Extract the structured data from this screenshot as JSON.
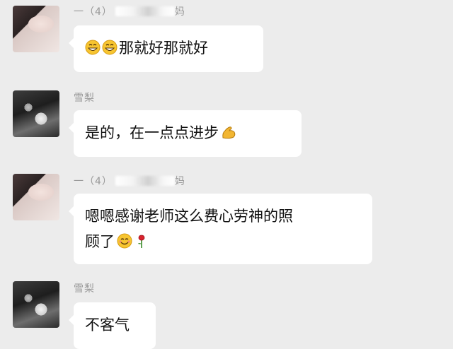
{
  "messages": [
    {
      "sender_prefix": "一（4）",
      "sender_suffix": "妈",
      "text": "那就好那就好",
      "emojis": [
        "grin-emoji",
        "grin-emoji"
      ]
    },
    {
      "sender": "雪梨",
      "text": "是的，在一点点进步",
      "emojis": [
        "flexed-biceps-emoji"
      ]
    },
    {
      "sender_prefix": "一（4）",
      "sender_suffix": "妈",
      "text_line1": "嗯嗯感谢老师这么费心劳神的照",
      "text_line2": "顾了",
      "emojis": [
        "smile-emoji",
        "rose-emoji"
      ]
    },
    {
      "sender": "雪梨",
      "text": "不客气"
    }
  ],
  "colors": {
    "chat_bg": "#ececec",
    "bubble_bg": "#ffffff",
    "sender_text": "#999999"
  }
}
